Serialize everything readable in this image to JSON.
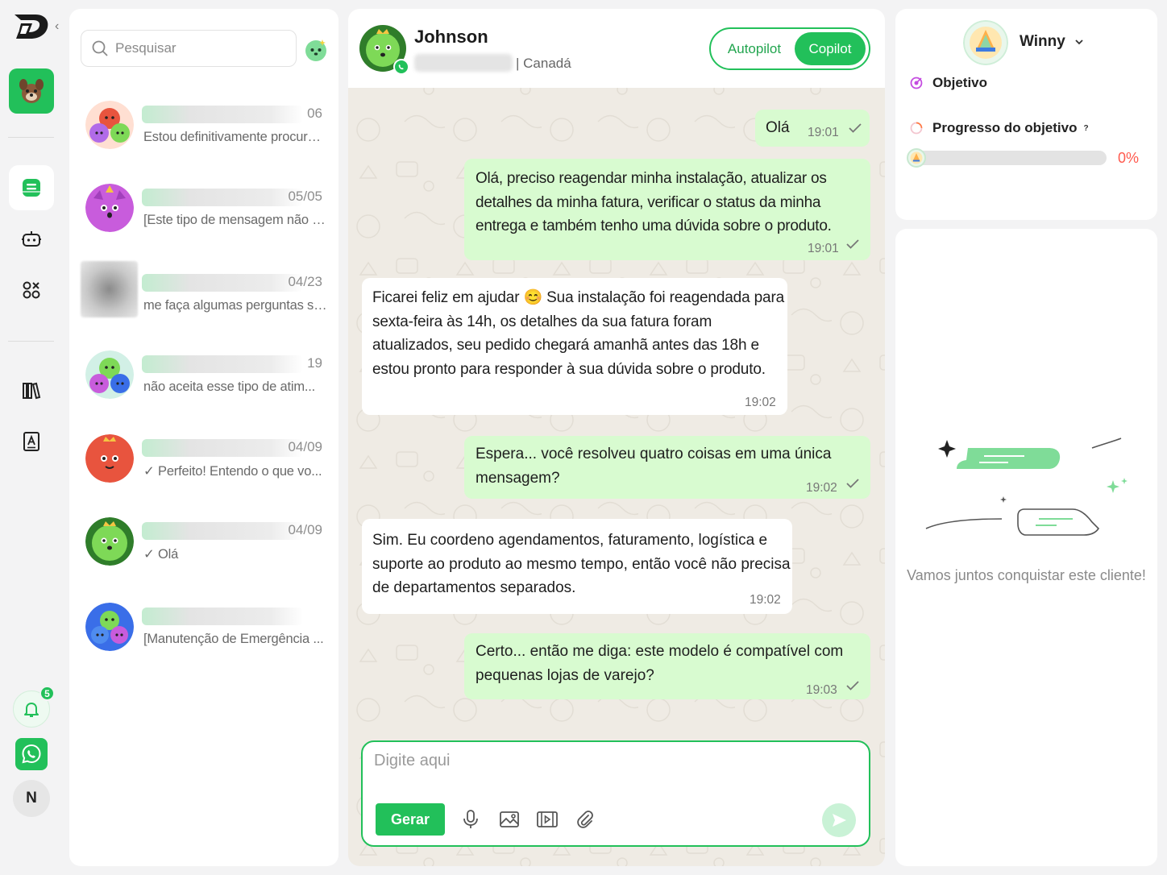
{
  "sidebar": {
    "badge_count": "5",
    "user_initial": "N"
  },
  "search": {
    "placeholder": "Pesquisar"
  },
  "conversations": [
    {
      "date": "06",
      "preview": "Estou definitivamente procurando..."
    },
    {
      "date": "05/05",
      "preview": "[Este tipo de mensagem não é ..."
    },
    {
      "date": "04/23",
      "preview": "me faça algumas perguntas sob..."
    },
    {
      "date": "19",
      "preview": "não aceita esse tipo de atim..."
    },
    {
      "date": "04/09",
      "preview": "✓ Perfeito! Entendo o que vo..."
    },
    {
      "date": "04/09",
      "preview": "✓ Olá"
    },
    {
      "date": "",
      "preview": "[Manutenção de Emergência ..."
    }
  ],
  "chat": {
    "contact_name": "Johnson",
    "contact_location": "| Canadá",
    "modes": {
      "autopilot": "Autopilot",
      "copilot": "Copilot",
      "active": "Copilot"
    },
    "messages": [
      {
        "dir": "out",
        "text": "Olá",
        "time": "19:01"
      },
      {
        "dir": "out",
        "text": "Olá, preciso reagendar minha instalação, atualizar os detalhes da minha fatura, verificar o status da minha entrega e também tenho uma dúvida sobre o produto.",
        "time": "19:01"
      },
      {
        "dir": "in",
        "text": "Ficarei feliz em ajudar 😊 Sua instalação foi reagendada para sexta-feira às 14h, os detalhes da sua fatura foram atualizados, seu pedido chegará amanhã antes das 18h e estou pronto para responder à sua dúvida sobre o produto.",
        "time": "19:02"
      },
      {
        "dir": "out",
        "text": "Espera... você resolveu quatro coisas em uma única mensagem?",
        "time": "19:02"
      },
      {
        "dir": "in",
        "text": "Sim. Eu coordeno agendamentos, faturamento, logística e suporte ao produto ao mesmo tempo, então você não precisa de departamentos separados.",
        "time": "19:02"
      },
      {
        "dir": "out",
        "text": "Certo... então me diga: este modelo é compatível com pequenas lojas de varejo?",
        "time": "19:03"
      }
    ],
    "composer": {
      "placeholder": "Digite aqui",
      "generate_label": "Gerar"
    }
  },
  "goal_panel": {
    "agent_name": "Winny",
    "objective_label": "Objetivo",
    "progress_label": "Progresso do objetivo",
    "help_mark": "?",
    "progress_value": 0,
    "progress_text": "0%",
    "empty_message": "Vamos juntos conquistar este cliente!"
  },
  "colors": {
    "accent": "#22c05a",
    "outgoing_bubble": "#d8fbd0",
    "progress_text": "#ff5a4e"
  }
}
